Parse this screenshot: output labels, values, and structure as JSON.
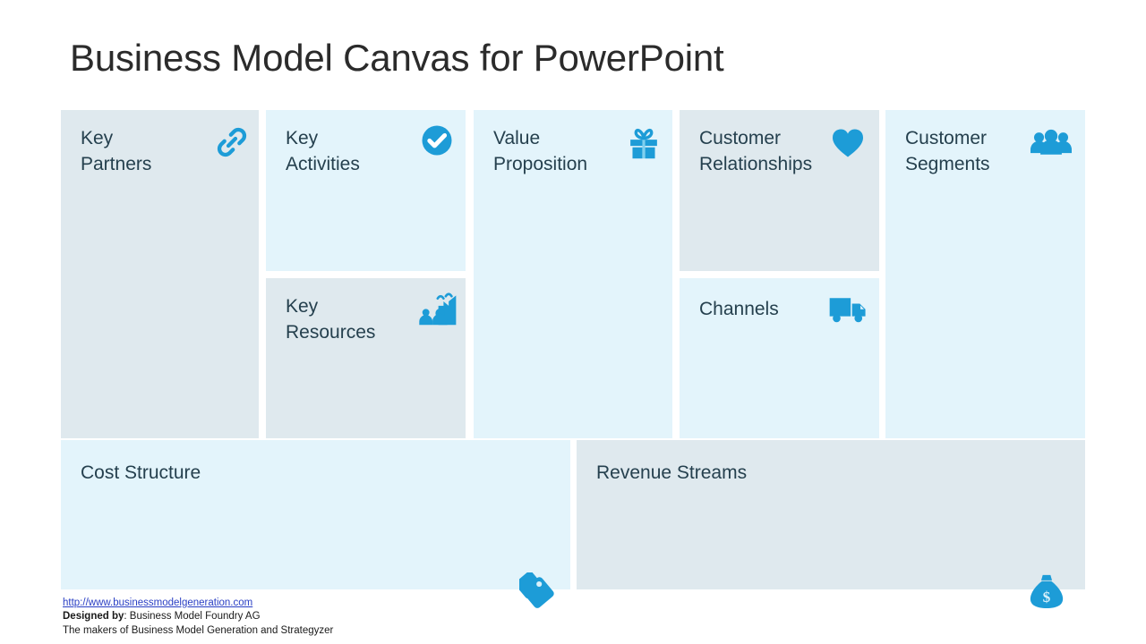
{
  "slide": {
    "title": "Business Model Canvas for PowerPoint",
    "background_color": "#ffffff"
  },
  "theme": {
    "icon_color": "#1d9cd7",
    "block_light_bg": "#e3f4fb",
    "block_grey_bg": "#dfe9ee",
    "label_color": "#25404e",
    "title_color": "#2b2b2b",
    "link_color": "#2a3fc4"
  },
  "canvas": {
    "blocks": [
      {
        "id": "key-partners",
        "label": "Key\nPartners",
        "icon": "chain-link-icon",
        "bg": "grey"
      },
      {
        "id": "key-activities",
        "label": "Key\nActivities",
        "icon": "check-circle-icon",
        "bg": "light"
      },
      {
        "id": "key-resources",
        "label": "Key\nResources",
        "icon": "factory-people-icon",
        "bg": "grey"
      },
      {
        "id": "value-proposition",
        "label": "Value\nProposition",
        "icon": "gift-box-icon",
        "bg": "light"
      },
      {
        "id": "customer-relationships",
        "label": "Customer\nRelationships",
        "icon": "heart-icon",
        "bg": "grey"
      },
      {
        "id": "channels",
        "label": "Channels",
        "icon": "delivery-truck-icon",
        "bg": "light"
      },
      {
        "id": "customer-segments",
        "label": "Customer\nSegments",
        "icon": "people-group-icon",
        "bg": "light"
      },
      {
        "id": "cost-structure",
        "label": "Cost Structure",
        "icon": "price-tags-icon",
        "bg": "light"
      },
      {
        "id": "revenue-streams",
        "label": "Revenue Streams",
        "icon": "money-bag-icon",
        "bg": "grey"
      }
    ]
  },
  "footer": {
    "url": "http://www.businessmodelgeneration.com",
    "designed_by_label": "Designed by",
    "designed_by_value": ": Business Model Foundry AG",
    "makers_line": "The makers of Business Model Generation and Strategyzer"
  }
}
